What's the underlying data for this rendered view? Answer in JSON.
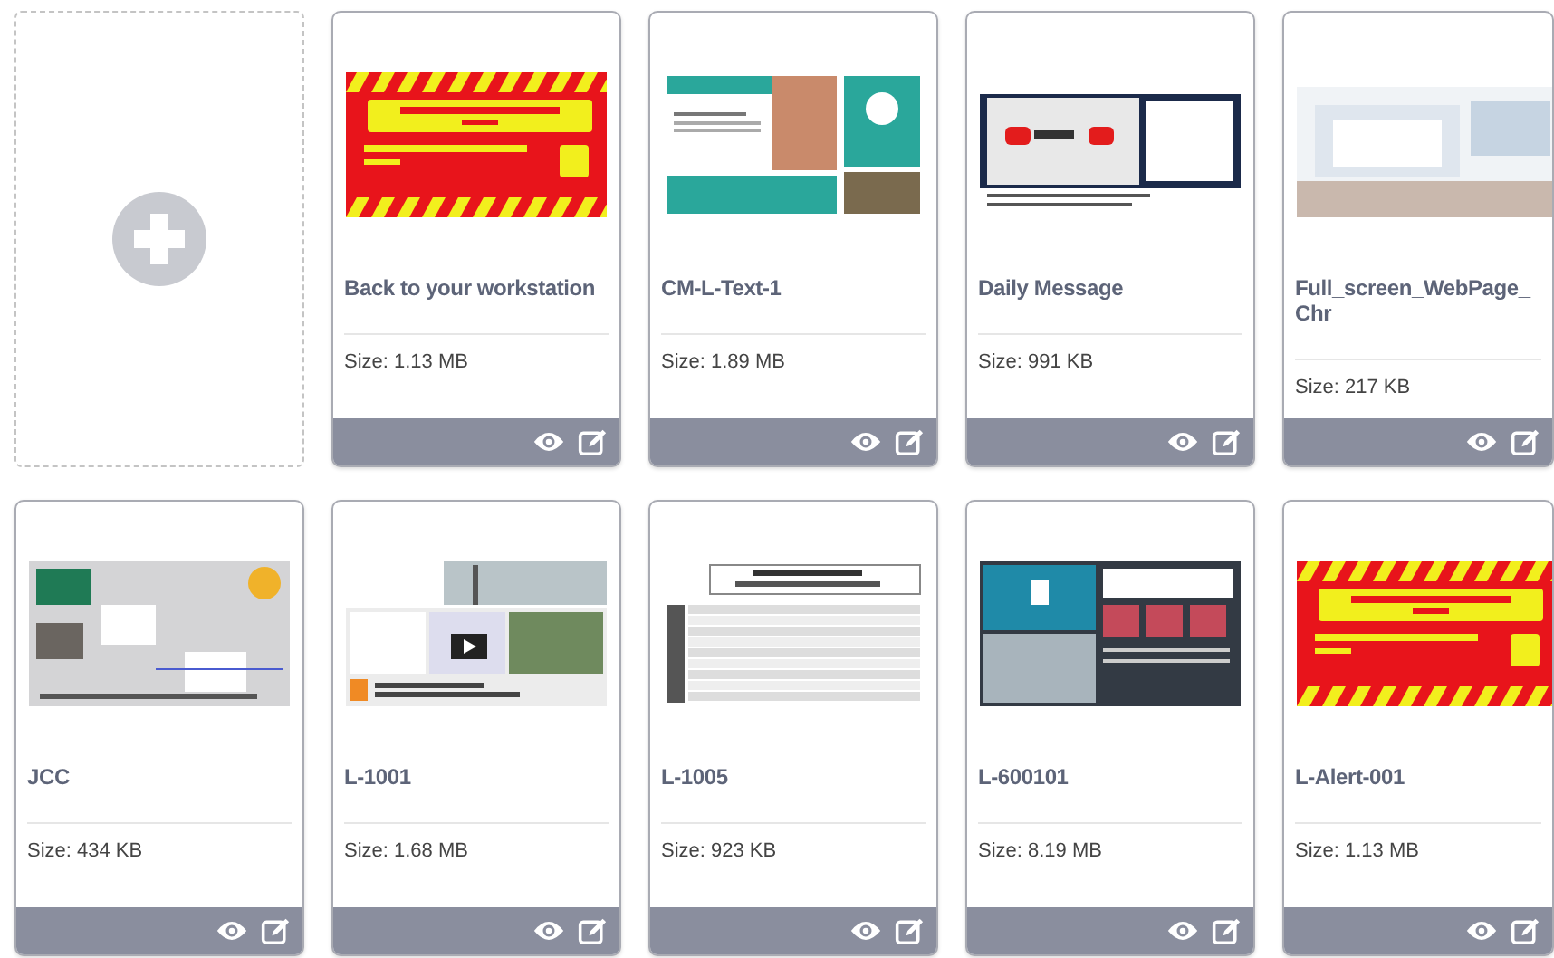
{
  "add_card": {
    "kind": "add"
  },
  "cards": [
    {
      "title": "Back to your workstation",
      "size": "Size: 1.13 MB",
      "kind": "alert"
    },
    {
      "title": "CM-L-Text-1",
      "size": "Size: 1.89 MB",
      "kind": "teal"
    },
    {
      "title": "Daily Message",
      "size": "Size: 991 KB",
      "kind": "video"
    },
    {
      "title": "Full_screen_WebPage_Chr",
      "size": "Size: 217 KB",
      "kind": "web"
    },
    {
      "title": "JCC",
      "size": "Size: 434 KB",
      "kind": "gray"
    },
    {
      "title": "L-1001",
      "size": "Size: 1.68 MB",
      "kind": "news"
    },
    {
      "title": "L-1005",
      "size": "Size: 923 KB",
      "kind": "table"
    },
    {
      "title": "L-600101",
      "size": "Size: 8.19 MB",
      "kind": "dark"
    },
    {
      "title": "L-Alert-001",
      "size": "Size: 1.13 MB",
      "kind": "alert"
    }
  ]
}
